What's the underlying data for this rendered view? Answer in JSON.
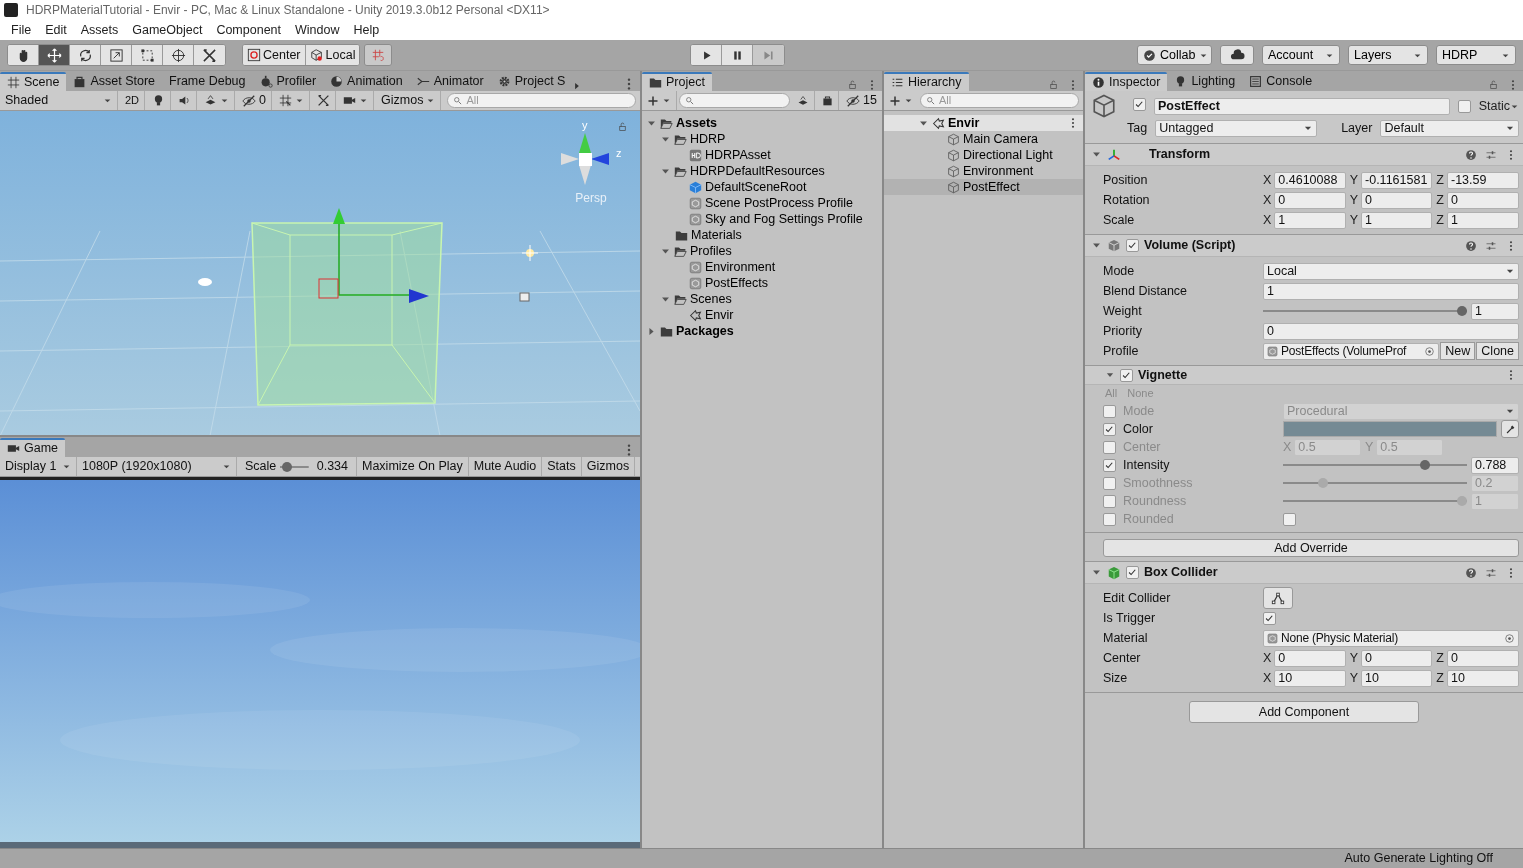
{
  "window": {
    "title": "HDRPMaterialTutorial - Envir - PC, Mac & Linux Standalone - Unity 2019.3.0b12 Personal <DX11>"
  },
  "menu": [
    "File",
    "Edit",
    "Assets",
    "GameObject",
    "Component",
    "Window",
    "Help"
  ],
  "toolbar": {
    "tools": [
      {
        "selected": false
      },
      {
        "selected": true
      },
      {
        "selected": false
      },
      {
        "selected": false
      },
      {
        "selected": false
      },
      {
        "selected": false
      },
      {
        "selected": false
      }
    ],
    "pivot": [
      "Center",
      "Local"
    ],
    "play": [
      {
        "disabled": false
      },
      {
        "disabled": false
      },
      {
        "disabled": true
      }
    ],
    "collab": "Collab",
    "account": "Account",
    "layers": "Layers",
    "layout": "HDRP"
  },
  "scene": {
    "tabs": [
      {
        "label": "Scene",
        "selected": true
      },
      {
        "label": "Asset Store",
        "selected": false
      },
      {
        "label": "Frame Debug",
        "selected": false
      },
      {
        "label": "Profiler",
        "selected": false
      },
      {
        "label": "Animation",
        "selected": false
      },
      {
        "label": "Animator",
        "selected": false
      },
      {
        "label": "Project S",
        "selected": false
      }
    ],
    "shading": "Shaded",
    "mode_2d": "2D",
    "hidden_count": "0",
    "gizmos": "Gizmos",
    "search": {
      "placeholder": "All"
    },
    "gizmo_axes": [
      "y",
      "z"
    ],
    "projection": "Persp"
  },
  "game": {
    "tabs": [
      {
        "label": "Game",
        "selected": true
      }
    ],
    "display": "Display 1",
    "resolution": "1080P (1920x1080)",
    "scale_label": "Scale",
    "scale": {
      "level": 0.1,
      "reading": "0.334"
    },
    "toggles": [
      "Maximize On Play",
      "Mute Audio",
      "Stats",
      "Gizmos"
    ]
  },
  "project": {
    "tabs": [
      {
        "label": "Project",
        "selected": true
      }
    ],
    "hidden_count": "15",
    "tree": [
      {
        "label": "Assets",
        "kind": "folder",
        "expanded": true,
        "children": [
          {
            "label": "HDRP",
            "kind": "folder",
            "expanded": true,
            "children": [
              {
                "label": "HDRPAsset",
                "kind": "asset"
              }
            ]
          },
          {
            "label": "HDRPDefaultResources",
            "kind": "folder",
            "expanded": true,
            "children": [
              {
                "label": "DefaultSceneRoot",
                "kind": "prefab"
              },
              {
                "label": "Scene PostProcess Profile",
                "kind": "profile"
              },
              {
                "label": "Sky and Fog Settings Profile",
                "kind": "profile"
              }
            ]
          },
          {
            "label": "Materials",
            "kind": "folder"
          },
          {
            "label": "Profiles",
            "kind": "folder",
            "expanded": true,
            "children": [
              {
                "label": "Environment",
                "kind": "profile"
              },
              {
                "label": "PostEffects",
                "kind": "profile"
              }
            ]
          },
          {
            "label": "Scenes",
            "kind": "folder",
            "expanded": true,
            "children": [
              {
                "label": "Envir",
                "kind": "scene"
              }
            ]
          }
        ]
      },
      {
        "label": "Packages",
        "kind": "folder",
        "expanded": false
      }
    ]
  },
  "hierarchy": {
    "tabs": [
      {
        "label": "Hierarchy",
        "selected": true
      }
    ],
    "search": {
      "placeholder": "All"
    },
    "tree": [
      {
        "label": "Envir",
        "kind": "scene",
        "expanded": true,
        "selected": false,
        "children": [
          {
            "label": "Main Camera",
            "kind": "object",
            "selected": false
          },
          {
            "label": "Directional Light",
            "kind": "object",
            "selected": false
          },
          {
            "label": "Environment",
            "kind": "object",
            "selected": false
          },
          {
            "label": "PostEffect",
            "kind": "object",
            "selected": true
          }
        ]
      }
    ]
  },
  "inspector": {
    "tabs": [
      {
        "label": "Inspector",
        "selected": true
      },
      {
        "label": "Lighting",
        "selected": false
      },
      {
        "label": "Console",
        "selected": false
      }
    ],
    "object": {
      "active": true,
      "name": "PostEffect",
      "static": false,
      "static_label": "Static",
      "tag_label": "Tag",
      "tag": "Untagged",
      "layer_label": "Layer",
      "layer": "Default"
    },
    "components": [
      {
        "title": "Transform",
        "rows": [
          {
            "kind": "vector",
            "label": "Position",
            "values": [
              {
                "axis": "X",
                "value": "0.4610088"
              },
              {
                "axis": "Y",
                "value": "-0.1161581"
              },
              {
                "axis": "Z",
                "value": "-13.59"
              }
            ]
          },
          {
            "kind": "vector",
            "label": "Rotation",
            "values": [
              {
                "axis": "X",
                "value": "0"
              },
              {
                "axis": "Y",
                "value": "0"
              },
              {
                "axis": "Z",
                "value": "0"
              }
            ]
          },
          {
            "kind": "vector",
            "label": "Scale",
            "values": [
              {
                "axis": "X",
                "value": "1"
              },
              {
                "axis": "Y",
                "value": "1"
              },
              {
                "axis": "Z",
                "value": "1"
              }
            ]
          }
        ]
      },
      {
        "title": "Volume (Script)",
        "enabled": true,
        "rows": [
          {
            "kind": "dropdown",
            "label": "Mode",
            "value": "Local"
          },
          {
            "kind": "field",
            "label": "Blend Distance",
            "value": "1"
          },
          {
            "kind": "slider",
            "label": "Weight",
            "level": 1,
            "value": "1"
          },
          {
            "kind": "field",
            "label": "Priority",
            "value": "0"
          },
          {
            "kind": "object",
            "label": "Profile",
            "value": "PostEffects (VolumeProf",
            "buttons": [
              "New",
              "Clone"
            ]
          }
        ],
        "override": {
          "title": "Vignette",
          "enabled": true,
          "links": [
            "All",
            "None"
          ],
          "rows": [
            {
              "kind": "dropdown",
              "label": "Mode",
              "overridden": false,
              "value": "Procedural"
            },
            {
              "kind": "color",
              "label": "Color",
              "overridden": true,
              "color": "#758a94"
            },
            {
              "kind": "vector",
              "label": "Center",
              "overridden": false,
              "values": [
                {
                  "axis": "X",
                  "value": "0.5"
                },
                {
                  "axis": "Y",
                  "value": "0.5"
                }
              ]
            },
            {
              "kind": "slider",
              "label": "Intensity",
              "overridden": true,
              "level": 0.788,
              "value": "0.788"
            },
            {
              "kind": "slider",
              "label": "Smoothness",
              "overridden": false,
              "level": 0.2,
              "value": "0.2"
            },
            {
              "kind": "slider",
              "label": "Roundness",
              "overridden": false,
              "level": 1,
              "value": "1"
            },
            {
              "kind": "toggle",
              "label": "Rounded",
              "overridden": false,
              "checked": false
            }
          ],
          "button": "Add Override"
        }
      },
      {
        "title": "Box Collider",
        "enabled": true,
        "rows": [
          {
            "kind": "edit",
            "label": "Edit Collider"
          },
          {
            "kind": "toggle",
            "label": "Is Trigger",
            "checked": true
          },
          {
            "kind": "object",
            "label": "Material",
            "value": "None (Physic Material)"
          },
          {
            "kind": "vector",
            "label": "Center",
            "values": [
              {
                "axis": "X",
                "value": "0"
              },
              {
                "axis": "Y",
                "value": "0"
              },
              {
                "axis": "Z",
                "value": "0"
              }
            ]
          },
          {
            "kind": "vector",
            "label": "Size",
            "values": [
              {
                "axis": "X",
                "value": "10"
              },
              {
                "axis": "Y",
                "value": "10"
              },
              {
                "axis": "Z",
                "value": "10"
              }
            ]
          }
        ]
      }
    ],
    "add_button": "Add Component"
  },
  "status_bar": "Auto Generate Lighting Off"
}
